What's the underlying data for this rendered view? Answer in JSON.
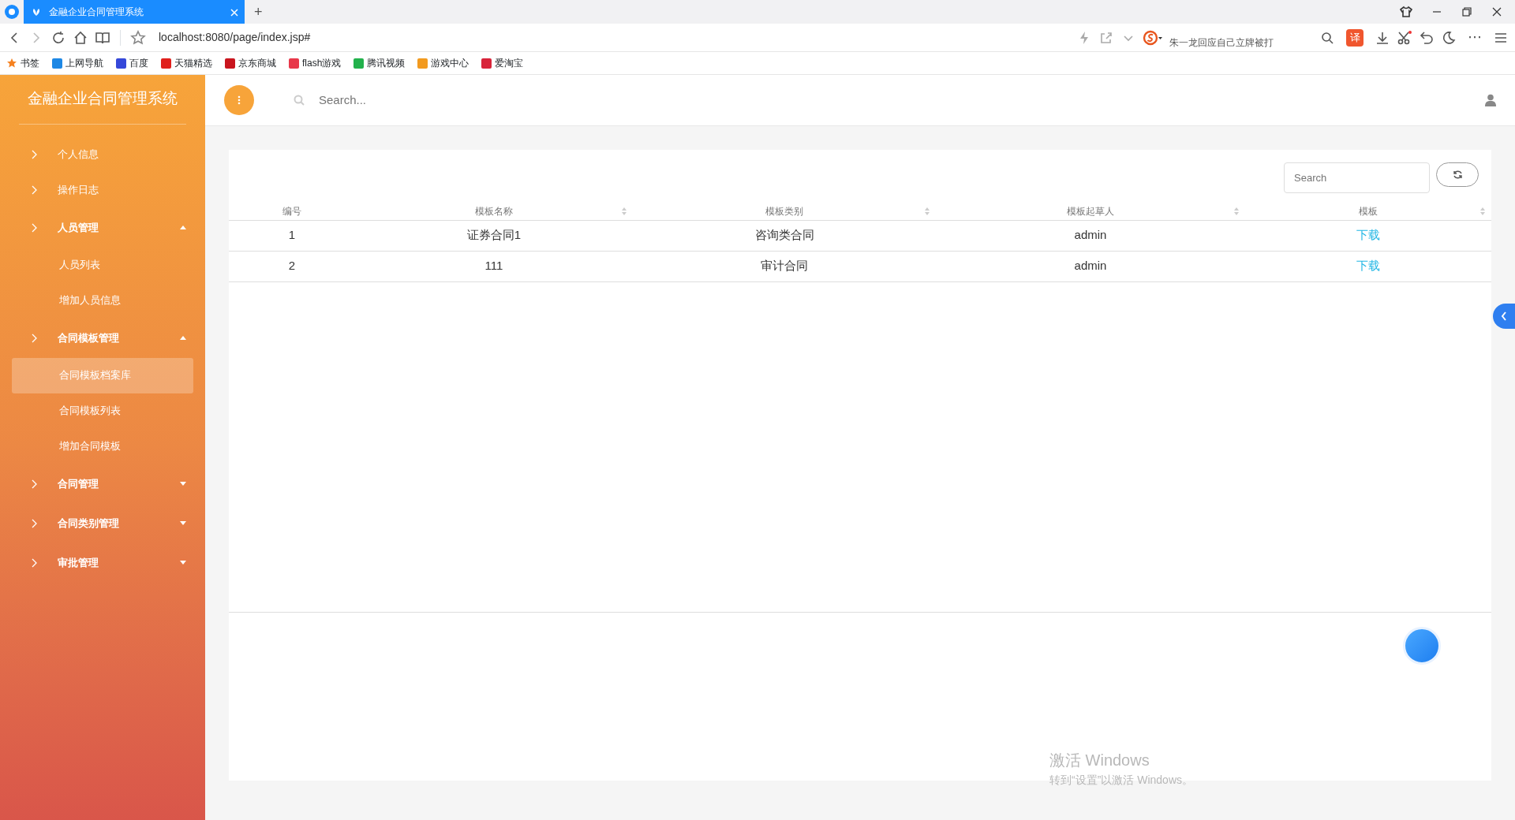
{
  "browser": {
    "tab_title": "金融企业合同管理系统",
    "new_tab": "+",
    "address": "localhost:8080/page/index.jsp#",
    "search_hint": "朱一龙回应自己立牌被打",
    "translate_label": "译",
    "more": "⋯",
    "bookmarks": [
      {
        "label": "书签",
        "color": "#f5811f"
      },
      {
        "label": "上网导航",
        "color": "#1e88e5"
      },
      {
        "label": "百度",
        "color": "#3548d9"
      },
      {
        "label": "天猫精选",
        "color": "#e0201c"
      },
      {
        "label": "京东商城",
        "color": "#c9151e"
      },
      {
        "label": "flash游戏",
        "color": "#e8384a"
      },
      {
        "label": "腾讯视频",
        "color": "#22b14c"
      },
      {
        "label": "游戏中心",
        "color": "#f29a1f"
      },
      {
        "label": "爱淘宝",
        "color": "#d8243a"
      }
    ]
  },
  "sidebar": {
    "title": "金融企业合同管理系统",
    "items": [
      {
        "kind": "link",
        "label": "个人信息",
        "selected": false
      },
      {
        "kind": "link",
        "label": "操作日志",
        "selected": false
      },
      {
        "kind": "group",
        "label": "人员管理",
        "expanded": true,
        "children": [
          {
            "label": "人员列表",
            "selected": false
          },
          {
            "label": "增加人员信息",
            "selected": false
          }
        ]
      },
      {
        "kind": "group",
        "label": "合同模板管理",
        "expanded": true,
        "children": [
          {
            "label": "合同模板档案库",
            "selected": true
          },
          {
            "label": "合同模板列表",
            "selected": false
          },
          {
            "label": "增加合同模板",
            "selected": false
          }
        ]
      },
      {
        "kind": "group",
        "label": "合同管理",
        "expanded": false
      },
      {
        "kind": "group",
        "label": "合同类别管理",
        "expanded": false
      },
      {
        "kind": "group",
        "label": "审批管理",
        "expanded": false
      }
    ]
  },
  "header": {
    "search": {
      "placeholder": "Search..."
    }
  },
  "table": {
    "search": {
      "placeholder": "Search"
    },
    "columns": [
      {
        "label": "编号",
        "sortable": false
      },
      {
        "label": "模板名称",
        "sortable": true
      },
      {
        "label": "模板类别",
        "sortable": true
      },
      {
        "label": "模板起草人",
        "sortable": true
      },
      {
        "label": "模板",
        "sortable": true
      }
    ],
    "rows": [
      {
        "cells": [
          "1",
          "证券合同1",
          "咨询类合同",
          "admin"
        ],
        "link": "下载"
      },
      {
        "cells": [
          "2",
          "111",
          "审计合同",
          "admin"
        ],
        "link": "下载"
      }
    ]
  },
  "windows_notice": {
    "title": "激活 Windows",
    "subtitle": "转到“设置”以激活 Windows。"
  }
}
